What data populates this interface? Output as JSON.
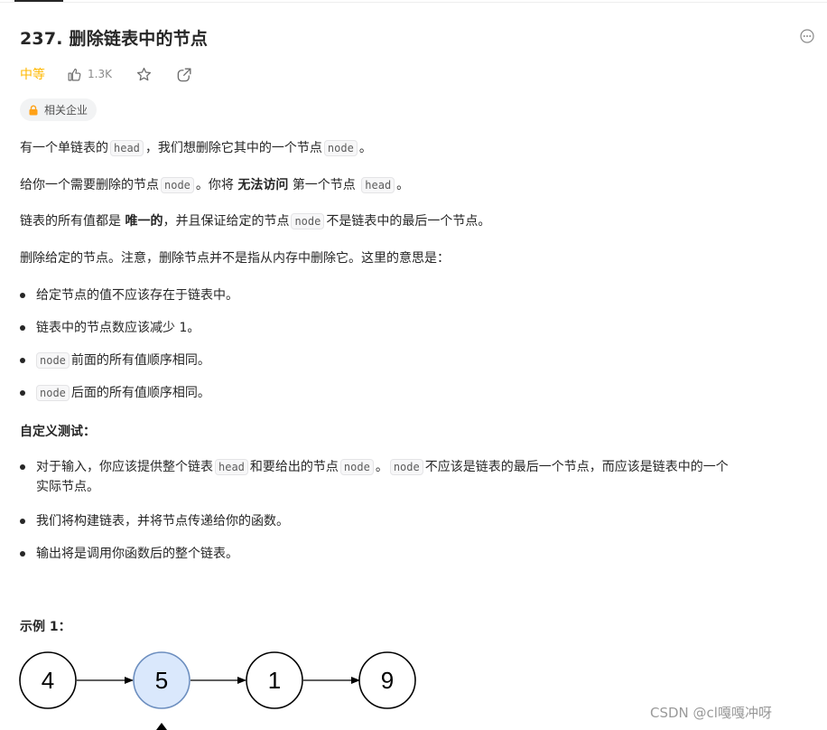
{
  "problem": {
    "title": "237. 删除链表中的节点",
    "difficulty": "中等",
    "likes": "1.3K",
    "company_tag": "相关企业"
  },
  "description": {
    "p1": {
      "a": "有一个单链表的",
      "code1": "head",
      "b": "，我们想删除它其中的一个节点",
      "code2": "node",
      "c": "。"
    },
    "p2": {
      "a": "给你一个需要删除的节点",
      "code1": "node",
      "b": "。你将",
      "bold": "无法访问",
      "c": "第一个节点",
      "code2": "head",
      "d": "。"
    },
    "p3": {
      "a": "链表的所有值都是",
      "bold": "唯一的",
      "b": "，并且保证给定的节点",
      "code1": "node",
      "c": "不是链表中的最后一个节点。"
    },
    "p4": "删除给定的节点。注意，删除节点并不是指从内存中删除它。这里的意思是：",
    "rules": [
      {
        "text": "给定节点的值不应该存在于链表中。"
      },
      {
        "text": "链表中的节点数应该减少 1。"
      },
      {
        "code": "node",
        "text": "前面的所有值顺序相同。"
      },
      {
        "code": "node",
        "text": "后面的所有值顺序相同。"
      }
    ]
  },
  "custom_test": {
    "heading": "自定义测试：",
    "item1": {
      "a": "对于输入，你应该提供整个链表",
      "code1": "head",
      "b": "和要给出的节点",
      "code2": "node",
      "c": "。",
      "code3": "node",
      "d": "不应该是链表的最后一个节点，而应该是链表中的一个",
      "line2": "实际节点。"
    },
    "item2": "我们将构建链表，并将节点传递给你的函数。",
    "item3": "输出将是调用你函数后的整个链表。"
  },
  "example": {
    "heading": "示例 1：",
    "nodes": [
      "4",
      "5",
      "1",
      "9"
    ],
    "highlighted_index": 1
  },
  "watermark": "CSDN @cl嘎嘎冲呀",
  "colors": {
    "difficulty": "#ffb800",
    "highlight_fill": "#dae8fc",
    "highlight_stroke": "#6c8ebf"
  },
  "icons": [
    "thumbs-up-icon",
    "star-icon",
    "share-icon",
    "more-icon",
    "lock-icon"
  ]
}
